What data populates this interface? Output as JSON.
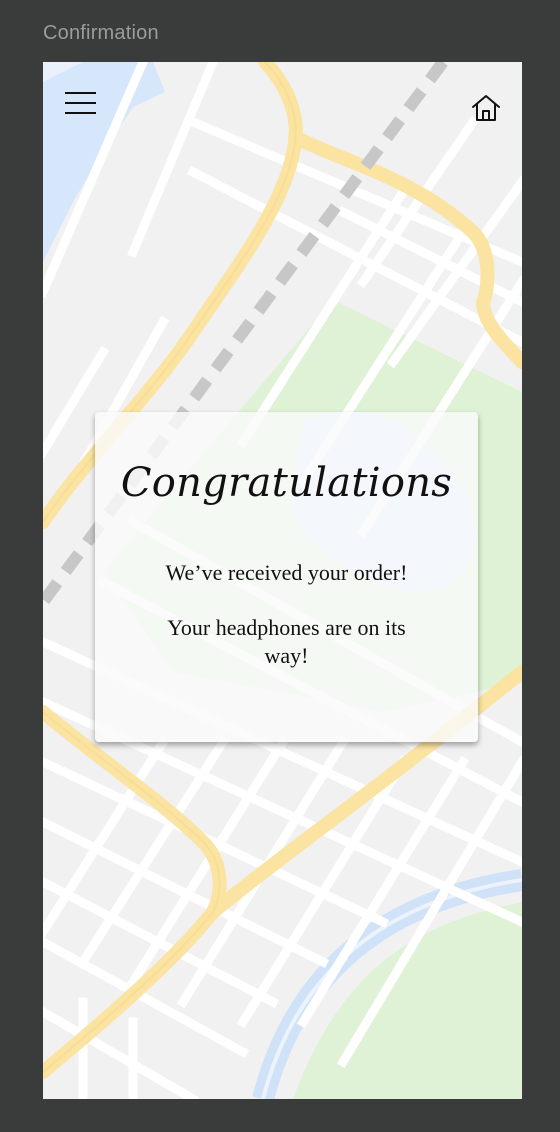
{
  "window": {
    "frame_title": "Confirmation"
  },
  "header": {
    "menu_icon": "hamburger-menu-icon",
    "home_icon": "home-icon"
  },
  "confirmation_card": {
    "title": "Congratulations",
    "message_line1": "We’ve received your order!",
    "message_line2": "Your headphones are on its way!"
  },
  "colors": {
    "page_background": "#3a3c3b",
    "map_base": "#f1f1f1",
    "map_roads_major": "#fbe3a2",
    "map_park": "#dff2d5",
    "map_water": "#d6e7fb",
    "card_background": "#fafafa"
  }
}
